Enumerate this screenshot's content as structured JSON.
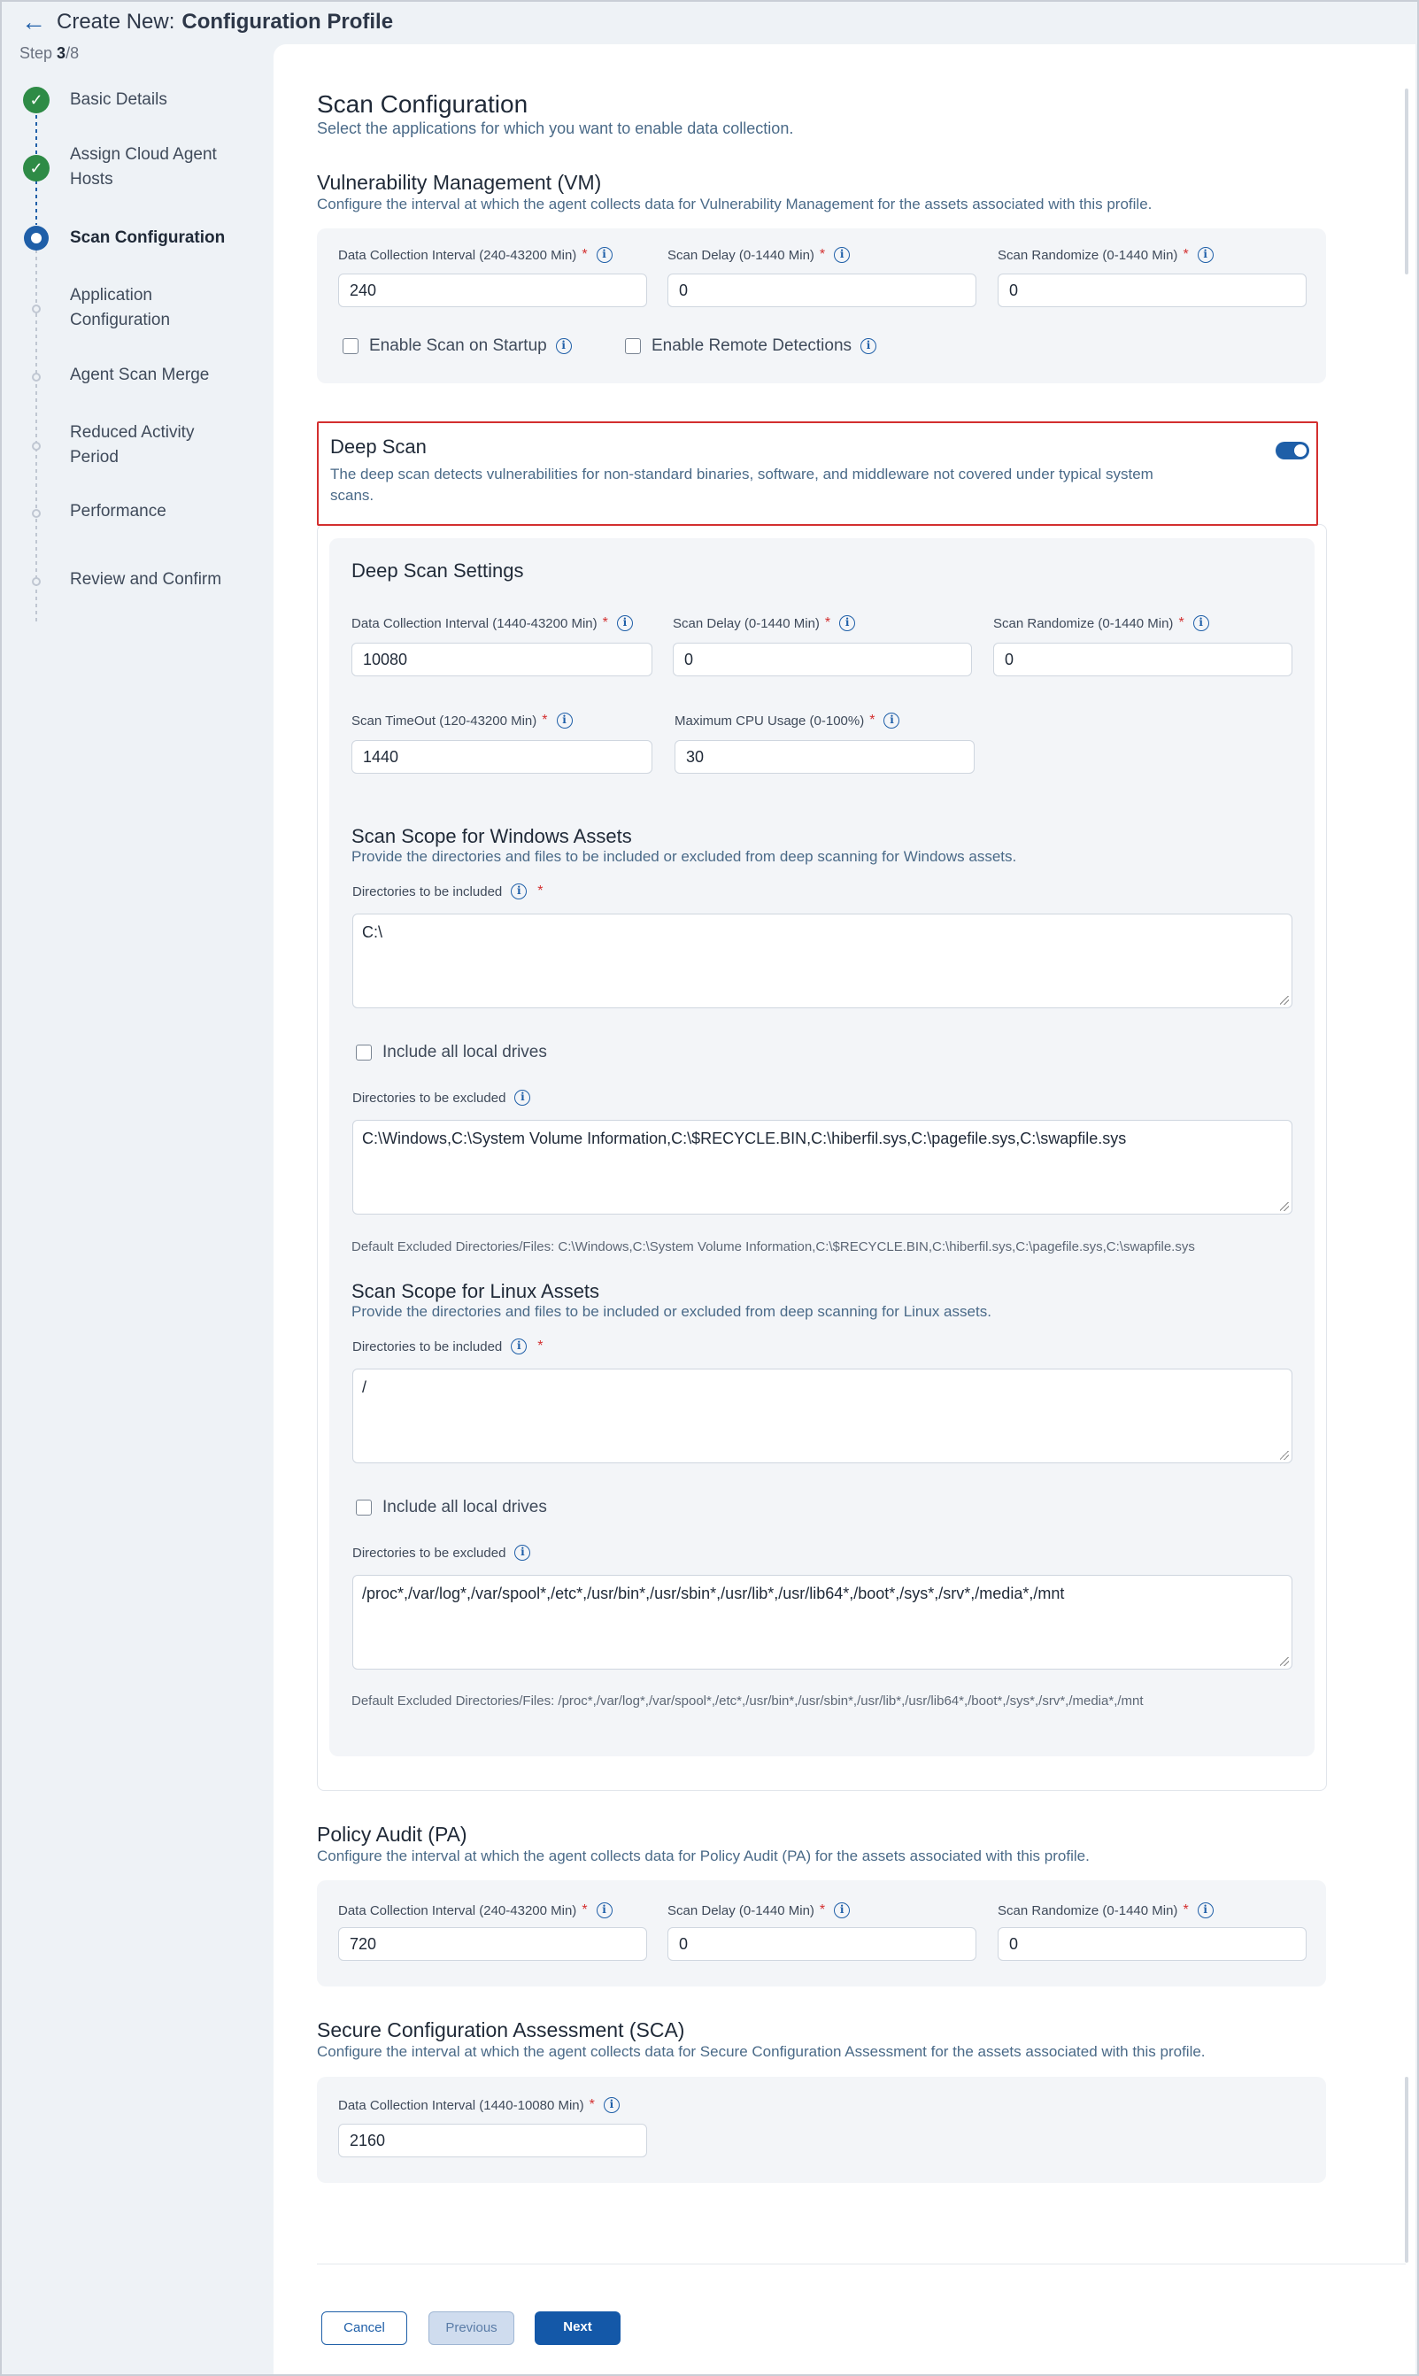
{
  "header": {
    "prefix": "Create New:",
    "title": "Configuration Profile",
    "step_label": "Step",
    "step_current": "3",
    "step_total": "/8"
  },
  "sidebar": {
    "steps": [
      {
        "label": "Basic Details",
        "status": "done"
      },
      {
        "label": "Assign Cloud Agent Hosts",
        "status": "done"
      },
      {
        "label": "Scan Configuration",
        "status": "current"
      },
      {
        "label": "Application Configuration",
        "status": "pending"
      },
      {
        "label": "Agent Scan Merge",
        "status": "pending"
      },
      {
        "label": "Reduced Activity Period",
        "status": "pending"
      },
      {
        "label": "Performance",
        "status": "pending"
      },
      {
        "label": "Review and Confirm",
        "status": "pending"
      }
    ]
  },
  "scan_config": {
    "title": "Scan Configuration",
    "subtitle": "Select the applications for which you want to enable data collection."
  },
  "vm": {
    "title": "Vulnerability Management (VM)",
    "subtitle": "Configure the interval at which the agent collects data for Vulnerability Management for the assets associated with this profile.",
    "interval_label": "Data Collection Interval (240-43200 Min)",
    "interval_value": "240",
    "delay_label": "Scan Delay (0-1440 Min)",
    "delay_value": "0",
    "randomize_label": "Scan Randomize (0-1440 Min)",
    "randomize_value": "0",
    "startup_label": "Enable Scan on Startup",
    "remote_label": "Enable Remote Detections"
  },
  "deep_scan": {
    "title": "Deep Scan",
    "description": "The deep scan detects vulnerabilities for non-standard binaries, software, and middleware not covered under typical system scans.",
    "enabled": true,
    "settings_title": "Deep Scan Settings",
    "interval_label": "Data Collection Interval (1440-43200 Min)",
    "interval_value": "10080",
    "delay_label": "Scan Delay (0-1440 Min)",
    "delay_value": "0",
    "randomize_label": "Scan Randomize (0-1440 Min)",
    "randomize_value": "0",
    "timeout_label": "Scan TimeOut (120-43200 Min)",
    "timeout_value": "1440",
    "cpu_label": "Maximum CPU Usage (0-100%)",
    "cpu_value": "30",
    "windows": {
      "title": "Scan Scope for Windows Assets",
      "subtitle": "Provide the directories and files to be included or excluded from deep scanning for Windows assets.",
      "included_label": "Directories to be included",
      "included_value": "C:\\",
      "local_drives_label": "Include all local drives",
      "excluded_label": "Directories to be excluded",
      "excluded_value": "C:\\Windows,C:\\System Volume Information,C:\\$RECYCLE.BIN,C:\\hiberfil.sys,C:\\pagefile.sys,C:\\swapfile.sys",
      "default_note": "Default Excluded Directories/Files: C:\\Windows,C:\\System Volume Information,C:\\$RECYCLE.BIN,C:\\hiberfil.sys,C:\\pagefile.sys,C:\\swapfile.sys"
    },
    "linux": {
      "title": "Scan Scope for Linux Assets",
      "subtitle": "Provide the directories and files to be included or excluded from deep scanning for Linux assets.",
      "included_label": "Directories to be included",
      "included_value": "/",
      "local_drives_label": "Include all local drives",
      "excluded_label": "Directories to be excluded",
      "excluded_value": "/proc*,/var/log*,/var/spool*,/etc*,/usr/bin*,/usr/sbin*,/usr/lib*,/usr/lib64*,/boot*,/sys*,/srv*,/media*,/mnt",
      "default_note": "Default Excluded Directories/Files: /proc*,/var/log*,/var/spool*,/etc*,/usr/bin*,/usr/sbin*,/usr/lib*,/usr/lib64*,/boot*,/sys*,/srv*,/media*,/mnt"
    }
  },
  "pa": {
    "title": "Policy Audit (PA)",
    "subtitle": "Configure the interval at which the agent collects data for Policy Audit (PA) for the assets associated with this profile.",
    "interval_label": "Data Collection Interval (240-43200 Min)",
    "interval_value": "720",
    "delay_label": "Scan Delay (0-1440 Min)",
    "delay_value": "0",
    "randomize_label": "Scan Randomize (0-1440 Min)",
    "randomize_value": "0"
  },
  "sca": {
    "title": "Secure Configuration Assessment (SCA)",
    "subtitle": "Configure the interval at which the agent collects data for Secure Configuration Assessment for the assets associated with this profile.",
    "interval_label": "Data Collection Interval (1440-10080 Min)",
    "interval_value": "2160"
  },
  "footer": {
    "cancel": "Cancel",
    "previous": "Previous",
    "next": "Next"
  },
  "icons": {
    "back": "arrow-left-icon",
    "check": "check-icon",
    "info": "info-icon"
  },
  "colors": {
    "primary": "#1f5fa8",
    "success": "#2e8b46",
    "highlight_border": "#d32f2f",
    "required": "#d32f2f"
  }
}
